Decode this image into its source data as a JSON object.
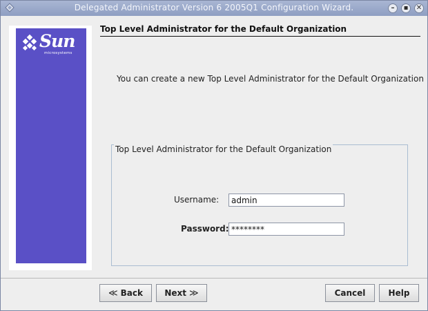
{
  "window": {
    "title": "Delegated Administrator Version 6 2005Q1 Configuration Wizard.",
    "controls": {
      "minimize_icon": "minimize-icon",
      "maximize_icon": "maximize-icon",
      "close_icon": "close-icon"
    }
  },
  "branding": {
    "logo_word": "Sun",
    "logo_sub": "microsystems",
    "sidebar_color": "#5a50c6"
  },
  "page": {
    "title": "Top Level Administrator for the Default Organization",
    "intro": "You can create a new Top Level Administrator for the Default Organization"
  },
  "group": {
    "legend": "Top Level Administrator for the Default Organization",
    "username_label": "Username:",
    "username_value": "admin",
    "password_label": "Password:",
    "password_value": "********"
  },
  "buttons": {
    "back": "Back",
    "next": "Next",
    "cancel": "Cancel",
    "help": "Help"
  }
}
